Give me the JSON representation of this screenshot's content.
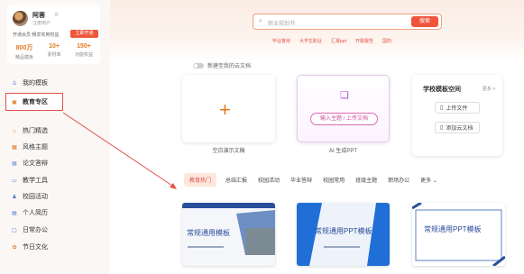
{
  "user": {
    "name": "阿蓉",
    "status": "注册用户",
    "promo": "开通会员 畅享实用权益",
    "vip_button": "立即开通",
    "stats": [
      {
        "num": "800万",
        "label": "精品模板"
      },
      {
        "num": "10+",
        "label": "素材库"
      },
      {
        "num": "150+",
        "label": "功能权益"
      }
    ]
  },
  "sidebar": {
    "items": [
      {
        "label": "我的模板",
        "icon": "user-icon"
      },
      {
        "label": "教育专区",
        "icon": "education-icon"
      },
      {
        "label": "热门精选",
        "icon": "hot-icon"
      },
      {
        "label": "风格主题",
        "icon": "style-icon"
      },
      {
        "label": "论文答辩",
        "icon": "thesis-icon"
      },
      {
        "label": "教学工具",
        "icon": "teaching-icon"
      },
      {
        "label": "校园活动",
        "icon": "campus-icon"
      },
      {
        "label": "个人简历",
        "icon": "resume-icon"
      },
      {
        "label": "日常办公",
        "icon": "office-icon"
      },
      {
        "label": "节日文化",
        "icon": "festival-icon"
      }
    ]
  },
  "search": {
    "placeholder": "职业规划书",
    "button": "搜索",
    "hot_tags": [
      "毕业答辩",
      "大学生职业",
      "汇报ppt",
      "开题报告",
      "国药"
    ]
  },
  "cloud_toggle_label": "新建至我的云文档",
  "cards": {
    "blank_caption": "空白演示文稿",
    "ai_button": "输入主题 / 上传文档",
    "ai_caption": "AI 生成PPT"
  },
  "school": {
    "title": "学校模板空间",
    "more": "更多 >",
    "upload": "上传文件",
    "add_cloud": "添加云文档"
  },
  "tabs": [
    "教育热门",
    "总结汇报",
    "校园活动",
    "毕业答辩",
    "校园常用",
    "班级主题",
    "职场办公",
    "更多 ⌄"
  ],
  "thumbnails": [
    "常规通用模板",
    "常规通用PPT模板",
    "常规通用PPT模板"
  ],
  "colors": {
    "accent": "#f0553a",
    "highlight_box": "#e0524a",
    "link_blue": "#4a78d6"
  }
}
